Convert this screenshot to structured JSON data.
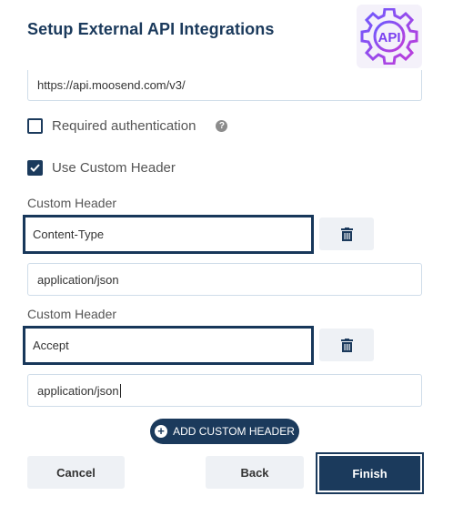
{
  "title": "Setup External API Integrations",
  "logo": {
    "text": "API",
    "icon": "gear-api-icon",
    "accent": "#8a3ff0"
  },
  "url_field": {
    "value": "https://api.moosend.com/v3/"
  },
  "required_auth": {
    "label": "Required authentication",
    "checked": false,
    "help_icon": "?"
  },
  "custom_header_toggle": {
    "label": "Use Custom Header",
    "checked": true
  },
  "headers": [
    {
      "label": "Custom Header",
      "name": "Content-Type",
      "value": "application/json"
    },
    {
      "label": "Custom Header",
      "name": "Accept",
      "value": "application/json"
    }
  ],
  "add_header_label": "ADD CUSTOM HEADER",
  "footer": {
    "cancel": "Cancel",
    "back": "Back",
    "finish": "Finish"
  },
  "colors": {
    "primary": "#1b3a5c",
    "field_border": "#cfdde9",
    "secondary_bg": "#eef1f5"
  }
}
